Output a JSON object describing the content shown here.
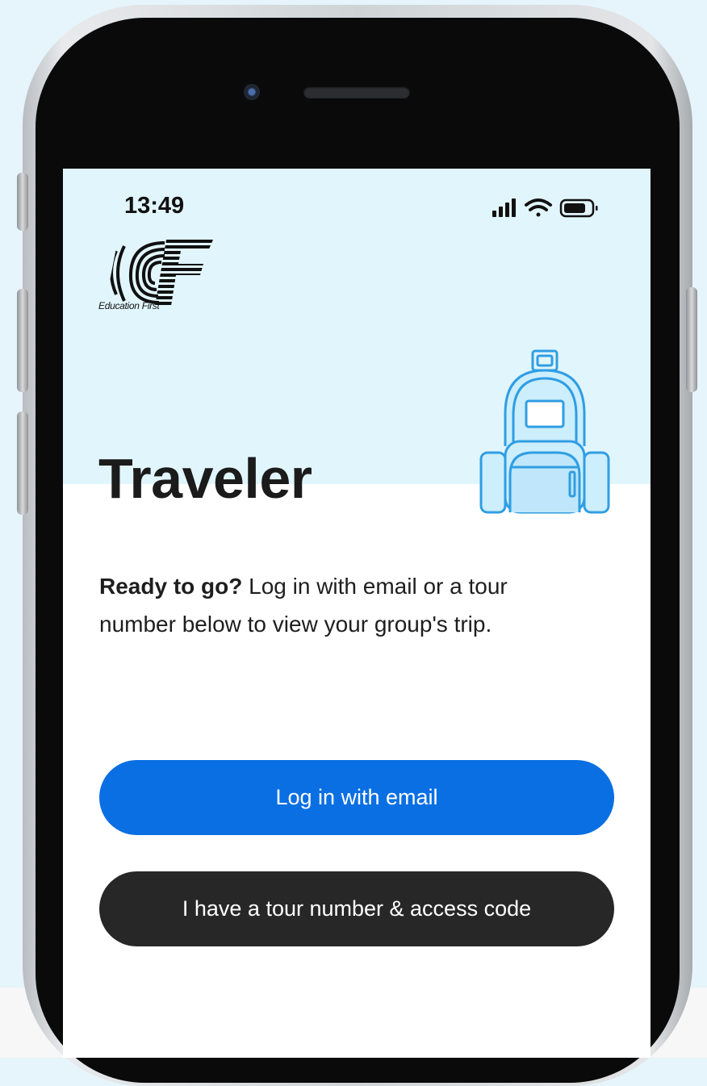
{
  "status_bar": {
    "time": "13:49"
  },
  "brand": {
    "logo_caption": "Education First"
  },
  "main": {
    "title": "Traveler",
    "intro_strong": "Ready to go?",
    "intro_rest": " Log in with email or a tour number below to view your group's trip."
  },
  "actions": {
    "email_login_label": "Log in with email",
    "tour_login_label": "I have a tour number & access code"
  },
  "colors": {
    "primary_button": "#0a6fe3",
    "secondary_button": "#272727",
    "header_background": "#e1f5fc",
    "illustration_blue": "#2f9ee3"
  },
  "icons": {
    "signal": "cellular-signal-icon",
    "wifi": "wifi-icon",
    "battery": "battery-icon",
    "illustration": "backpack-icon"
  }
}
